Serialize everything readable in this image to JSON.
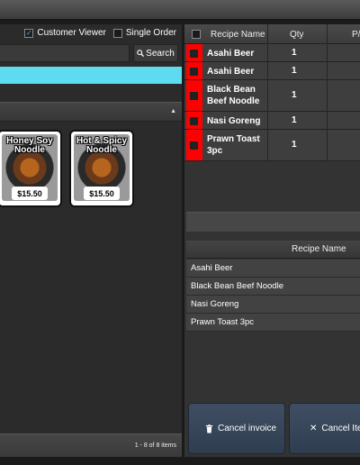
{
  "options": {
    "customer_viewer_label": "Customer Viewer",
    "customer_viewer_checked": true,
    "single_order_label": "Single Order",
    "single_order_checked": false
  },
  "search": {
    "button_label": "Search",
    "value": ""
  },
  "menu_items": [
    {
      "name": "Honey Soy Noodle",
      "price": "$15.50"
    },
    {
      "name": "Hot & Spicy Noodle",
      "price": "$15.50"
    }
  ],
  "pager": "1 - 8 of 8 items",
  "order_grid": {
    "columns": [
      "Recipe Name",
      "Qty",
      "P/"
    ],
    "rows": [
      {
        "name": "Asahi Beer",
        "qty": "1"
      },
      {
        "name": "Asahi Beer",
        "qty": "1"
      },
      {
        "name": "Black Bean Beef Noodle",
        "qty": "1"
      },
      {
        "name": "Nasi Goreng",
        "qty": "1"
      },
      {
        "name": "Prawn Toast 3pc",
        "qty": "1"
      }
    ]
  },
  "recipe_list": {
    "header": "Recipe Name",
    "items": [
      "Asahi Beer",
      "Black Bean Beef Noodle",
      "Nasi Goreng",
      "Prawn Toast 3pc"
    ]
  },
  "actions": {
    "cancel_invoice": "Cancel invoice",
    "cancel_item": "Cancel Iter"
  },
  "colors": {
    "accent_cyan": "#5ddcf0",
    "marker_red": "#ff0000",
    "button_blue": "#34465a"
  }
}
